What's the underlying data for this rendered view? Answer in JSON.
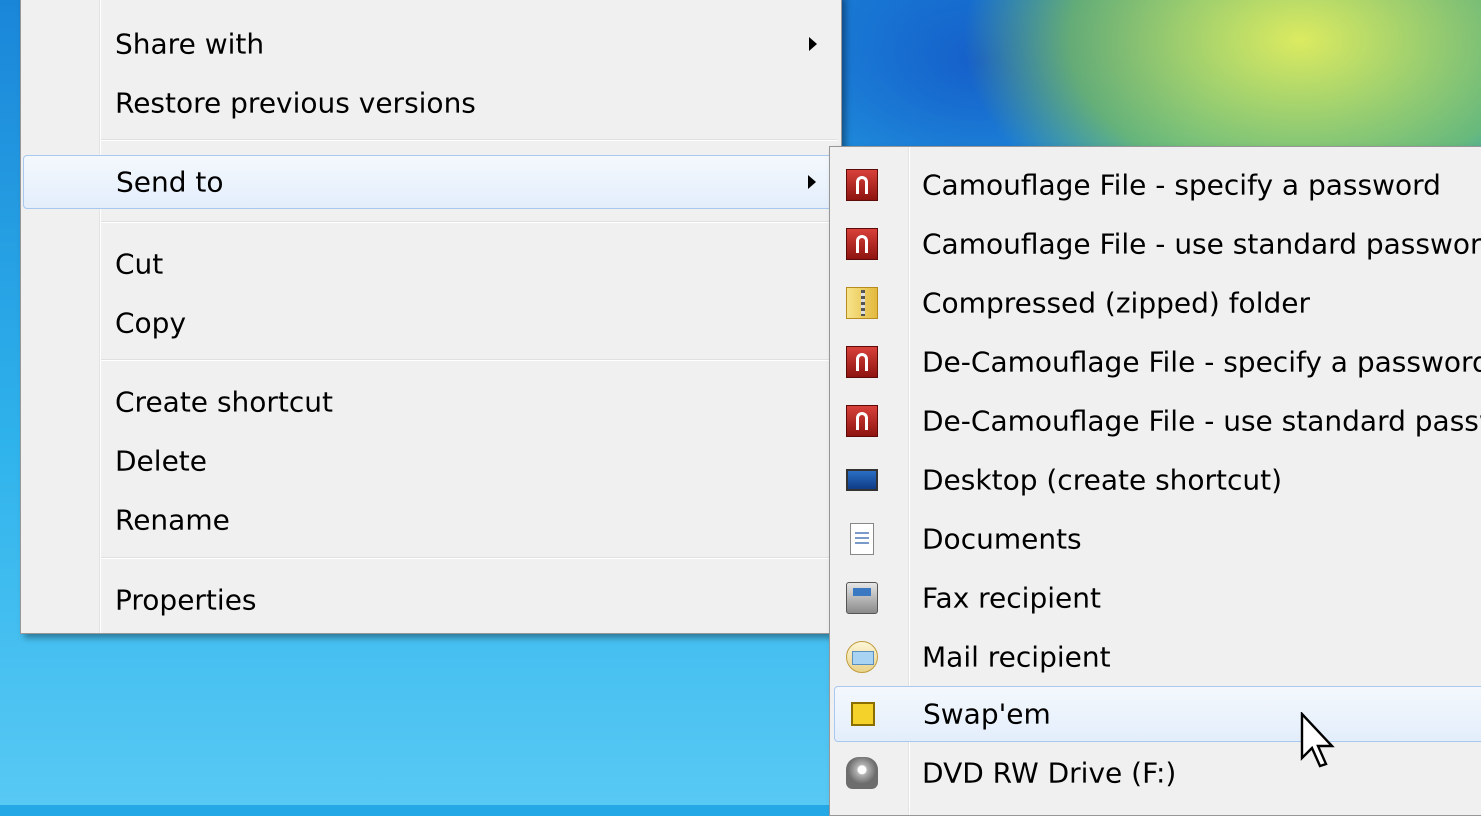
{
  "context_menu": {
    "items": [
      {
        "label": "Share with",
        "submenu": true
      },
      {
        "label": "Restore previous versions",
        "submenu": false
      },
      {
        "label": "Send to",
        "submenu": true,
        "highlighted": true
      },
      {
        "label": "Cut",
        "submenu": false
      },
      {
        "label": "Copy",
        "submenu": false
      },
      {
        "label": "Create shortcut",
        "submenu": false
      },
      {
        "label": "Delete",
        "submenu": false
      },
      {
        "label": "Rename",
        "submenu": false
      },
      {
        "label": "Properties",
        "submenu": false
      }
    ]
  },
  "send_to_menu": {
    "items": [
      {
        "label": "Camouflage File - specify a password",
        "icon": "camouflage-lock-icon"
      },
      {
        "label": "Camouflage File - use standard password",
        "icon": "camouflage-lock-icon"
      },
      {
        "label": "Compressed (zipped) folder",
        "icon": "zip-folder-icon"
      },
      {
        "label": "De-Camouflage File - specify a password",
        "icon": "camouflage-lock-icon"
      },
      {
        "label": "De-Camouflage File - use standard password",
        "icon": "camouflage-lock-icon"
      },
      {
        "label": "Desktop (create shortcut)",
        "icon": "desktop-icon"
      },
      {
        "label": "Documents",
        "icon": "document-icon"
      },
      {
        "label": "Fax recipient",
        "icon": "fax-icon"
      },
      {
        "label": "Mail recipient",
        "icon": "mail-icon"
      },
      {
        "label": "Swap'em",
        "icon": "swapem-icon",
        "highlighted": true
      },
      {
        "label": "DVD RW Drive (F:)",
        "icon": "dvd-drive-icon"
      }
    ]
  },
  "colors": {
    "menu_background": "#f0f0f0",
    "highlight_border": "#a8c8ef",
    "desktop_blue": "#25a9e6"
  }
}
